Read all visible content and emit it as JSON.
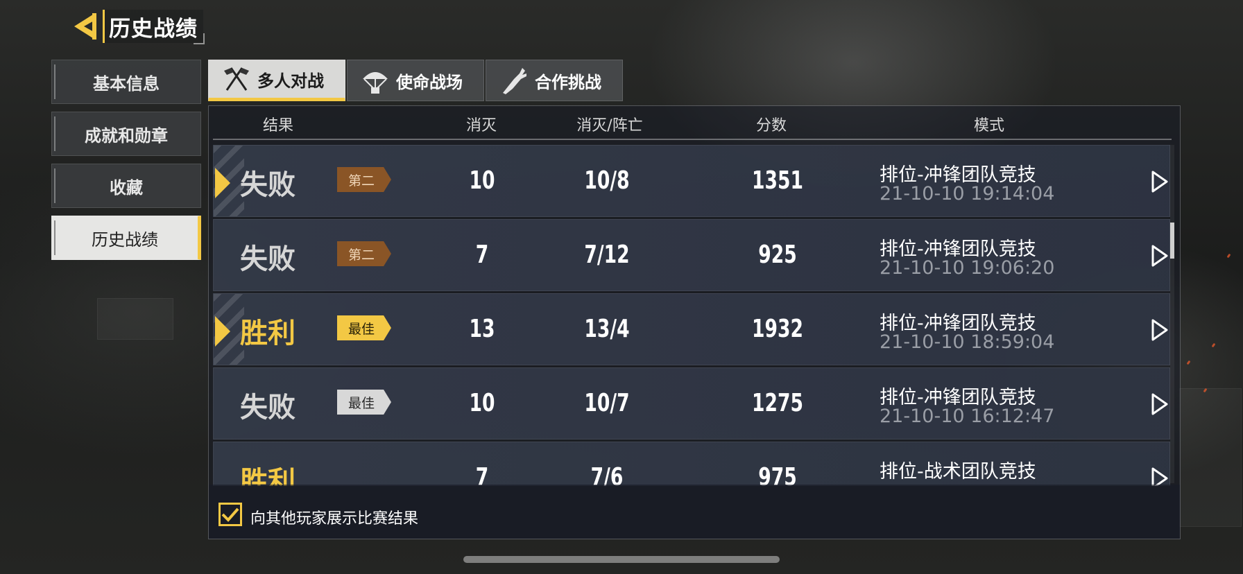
{
  "header": {
    "title": "历史战绩",
    "back_icon": "back-chevron-icon"
  },
  "sidebar": {
    "items": [
      {
        "label": "基本信息",
        "active": false
      },
      {
        "label": "成就和勋章",
        "active": false
      },
      {
        "label": "收藏",
        "active": false
      },
      {
        "label": "历史战绩",
        "active": true
      }
    ]
  },
  "tabs": [
    {
      "label": "多人对战",
      "icon": "crossed-flags-icon",
      "active": true
    },
    {
      "label": "使命战场",
      "icon": "parachute-icon",
      "active": false
    },
    {
      "label": "合作挑战",
      "icon": "zombie-arm-icon",
      "active": false
    }
  ],
  "table": {
    "columns": [
      "结果",
      "消灭",
      "消灭/阵亡",
      "分数",
      "模式"
    ],
    "rows": [
      {
        "result": "失败",
        "badge": "第二",
        "kills": "10",
        "kd": "10/8",
        "score": "1351",
        "mode": "排位-冲锋团队竞技",
        "time": "21-10-10 19:14:04",
        "selected": true
      },
      {
        "result": "失败",
        "badge": "第二",
        "kills": "7",
        "kd": "7/12",
        "score": "925",
        "mode": "排位-冲锋团队竞技",
        "time": "21-10-10 19:06:20",
        "selected": false
      },
      {
        "result": "胜利",
        "badge": "最佳",
        "kills": "13",
        "kd": "13/4",
        "score": "1932",
        "mode": "排位-冲锋团队竞技",
        "time": "21-10-10 18:59:04",
        "selected": true
      },
      {
        "result": "失败",
        "badge": "最佳",
        "kills": "10",
        "kd": "10/7",
        "score": "1275",
        "mode": "排位-冲锋团队竞技",
        "time": "21-10-10 16:12:47",
        "selected": false
      },
      {
        "result": "胜利",
        "badge": "",
        "kills": "7",
        "kd": "7/6",
        "score": "975",
        "mode": "排位-战术团队竞技",
        "time": "",
        "selected": false
      }
    ]
  },
  "footer": {
    "checkbox_label": "向其他玩家展示比赛结果",
    "checked": true
  },
  "colors": {
    "accent": "#f3c844",
    "badge_brown": "#8a5526",
    "badge_silver": "#d8d8d8",
    "win": "#f3c844",
    "loss": "#d6d6d6"
  }
}
